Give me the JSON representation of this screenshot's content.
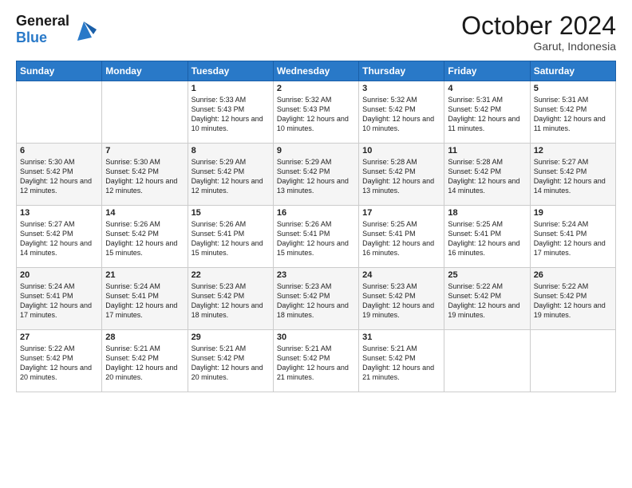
{
  "header": {
    "logo_line1": "General",
    "logo_line2": "Blue",
    "month": "October 2024",
    "location": "Garut, Indonesia"
  },
  "days_of_week": [
    "Sunday",
    "Monday",
    "Tuesday",
    "Wednesday",
    "Thursday",
    "Friday",
    "Saturday"
  ],
  "weeks": [
    [
      {
        "day": "",
        "content": ""
      },
      {
        "day": "",
        "content": ""
      },
      {
        "day": "1",
        "content": "Sunrise: 5:33 AM\nSunset: 5:43 PM\nDaylight: 12 hours and 10 minutes."
      },
      {
        "day": "2",
        "content": "Sunrise: 5:32 AM\nSunset: 5:43 PM\nDaylight: 12 hours and 10 minutes."
      },
      {
        "day": "3",
        "content": "Sunrise: 5:32 AM\nSunset: 5:42 PM\nDaylight: 12 hours and 10 minutes."
      },
      {
        "day": "4",
        "content": "Sunrise: 5:31 AM\nSunset: 5:42 PM\nDaylight: 12 hours and 11 minutes."
      },
      {
        "day": "5",
        "content": "Sunrise: 5:31 AM\nSunset: 5:42 PM\nDaylight: 12 hours and 11 minutes."
      }
    ],
    [
      {
        "day": "6",
        "content": "Sunrise: 5:30 AM\nSunset: 5:42 PM\nDaylight: 12 hours and 12 minutes."
      },
      {
        "day": "7",
        "content": "Sunrise: 5:30 AM\nSunset: 5:42 PM\nDaylight: 12 hours and 12 minutes."
      },
      {
        "day": "8",
        "content": "Sunrise: 5:29 AM\nSunset: 5:42 PM\nDaylight: 12 hours and 12 minutes."
      },
      {
        "day": "9",
        "content": "Sunrise: 5:29 AM\nSunset: 5:42 PM\nDaylight: 12 hours and 13 minutes."
      },
      {
        "day": "10",
        "content": "Sunrise: 5:28 AM\nSunset: 5:42 PM\nDaylight: 12 hours and 13 minutes."
      },
      {
        "day": "11",
        "content": "Sunrise: 5:28 AM\nSunset: 5:42 PM\nDaylight: 12 hours and 14 minutes."
      },
      {
        "day": "12",
        "content": "Sunrise: 5:27 AM\nSunset: 5:42 PM\nDaylight: 12 hours and 14 minutes."
      }
    ],
    [
      {
        "day": "13",
        "content": "Sunrise: 5:27 AM\nSunset: 5:42 PM\nDaylight: 12 hours and 14 minutes."
      },
      {
        "day": "14",
        "content": "Sunrise: 5:26 AM\nSunset: 5:42 PM\nDaylight: 12 hours and 15 minutes."
      },
      {
        "day": "15",
        "content": "Sunrise: 5:26 AM\nSunset: 5:41 PM\nDaylight: 12 hours and 15 minutes."
      },
      {
        "day": "16",
        "content": "Sunrise: 5:26 AM\nSunset: 5:41 PM\nDaylight: 12 hours and 15 minutes."
      },
      {
        "day": "17",
        "content": "Sunrise: 5:25 AM\nSunset: 5:41 PM\nDaylight: 12 hours and 16 minutes."
      },
      {
        "day": "18",
        "content": "Sunrise: 5:25 AM\nSunset: 5:41 PM\nDaylight: 12 hours and 16 minutes."
      },
      {
        "day": "19",
        "content": "Sunrise: 5:24 AM\nSunset: 5:41 PM\nDaylight: 12 hours and 17 minutes."
      }
    ],
    [
      {
        "day": "20",
        "content": "Sunrise: 5:24 AM\nSunset: 5:41 PM\nDaylight: 12 hours and 17 minutes."
      },
      {
        "day": "21",
        "content": "Sunrise: 5:24 AM\nSunset: 5:41 PM\nDaylight: 12 hours and 17 minutes."
      },
      {
        "day": "22",
        "content": "Sunrise: 5:23 AM\nSunset: 5:42 PM\nDaylight: 12 hours and 18 minutes."
      },
      {
        "day": "23",
        "content": "Sunrise: 5:23 AM\nSunset: 5:42 PM\nDaylight: 12 hours and 18 minutes."
      },
      {
        "day": "24",
        "content": "Sunrise: 5:23 AM\nSunset: 5:42 PM\nDaylight: 12 hours and 19 minutes."
      },
      {
        "day": "25",
        "content": "Sunrise: 5:22 AM\nSunset: 5:42 PM\nDaylight: 12 hours and 19 minutes."
      },
      {
        "day": "26",
        "content": "Sunrise: 5:22 AM\nSunset: 5:42 PM\nDaylight: 12 hours and 19 minutes."
      }
    ],
    [
      {
        "day": "27",
        "content": "Sunrise: 5:22 AM\nSunset: 5:42 PM\nDaylight: 12 hours and 20 minutes."
      },
      {
        "day": "28",
        "content": "Sunrise: 5:21 AM\nSunset: 5:42 PM\nDaylight: 12 hours and 20 minutes."
      },
      {
        "day": "29",
        "content": "Sunrise: 5:21 AM\nSunset: 5:42 PM\nDaylight: 12 hours and 20 minutes."
      },
      {
        "day": "30",
        "content": "Sunrise: 5:21 AM\nSunset: 5:42 PM\nDaylight: 12 hours and 21 minutes."
      },
      {
        "day": "31",
        "content": "Sunrise: 5:21 AM\nSunset: 5:42 PM\nDaylight: 12 hours and 21 minutes."
      },
      {
        "day": "",
        "content": ""
      },
      {
        "day": "",
        "content": ""
      }
    ]
  ]
}
